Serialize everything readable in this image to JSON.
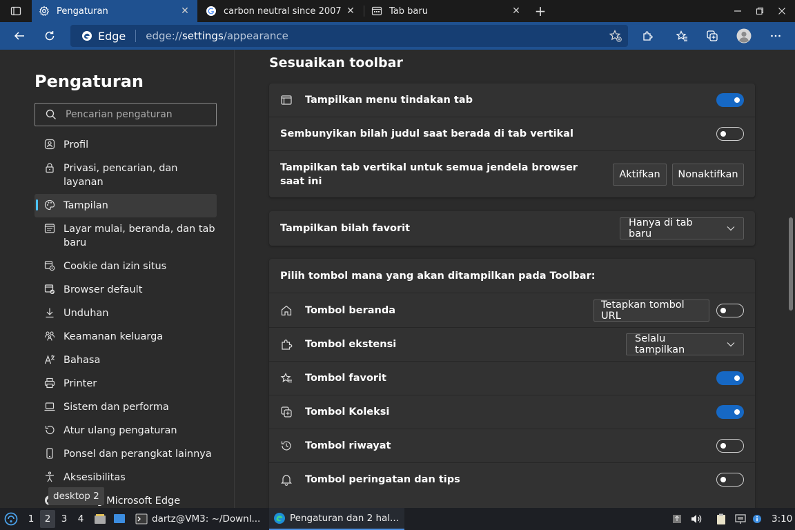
{
  "tabs": [
    {
      "title": "Pengaturan",
      "active": true
    },
    {
      "title": "carbon neutral since 2007",
      "active": false
    },
    {
      "title": "Tab baru",
      "active": false
    }
  ],
  "address": {
    "brand": "Edge",
    "url_prefix": "edge://",
    "url_host": "settings",
    "url_path": "/appearance"
  },
  "sidebar": {
    "title": "Pengaturan",
    "search_placeholder": "Pencarian pengaturan",
    "items": [
      {
        "label": "Profil",
        "icon": "profile-icon"
      },
      {
        "label": "Privasi, pencarian, dan layanan",
        "icon": "lock-icon"
      },
      {
        "label": "Tampilan",
        "icon": "palette-icon",
        "active": true
      },
      {
        "label": "Layar mulai, beranda, dan tab baru",
        "icon": "start-page-icon"
      },
      {
        "label": "Cookie dan izin situs",
        "icon": "cookie-icon"
      },
      {
        "label": "Browser default",
        "icon": "browser-default-icon"
      },
      {
        "label": "Unduhan",
        "icon": "download-icon"
      },
      {
        "label": "Keamanan keluarga",
        "icon": "family-icon"
      },
      {
        "label": "Bahasa",
        "icon": "language-icon"
      },
      {
        "label": "Printer",
        "icon": "printer-icon"
      },
      {
        "label": "Sistem dan performa",
        "icon": "laptop-icon"
      },
      {
        "label": "Atur ulang pengaturan",
        "icon": "reset-icon"
      },
      {
        "label": "Ponsel dan perangkat lainnya",
        "icon": "phone-icon"
      },
      {
        "label": "Aksesibilitas",
        "icon": "accessibility-icon"
      },
      {
        "label": "Tentang Microsoft Edge",
        "icon": "edge-logo-icon"
      }
    ]
  },
  "main": {
    "section_title": "Sesuaikan toolbar",
    "card1": {
      "row1": {
        "label": "Tampilkan menu tindakan tab",
        "toggle": true
      },
      "row2": {
        "label": "Sembunyikan bilah judul saat berada di tab vertikal",
        "toggle": false
      },
      "row3": {
        "label": "Tampilkan tab vertikal untuk semua jendela browser saat ini",
        "btn_on": "Aktifkan",
        "btn_off": "Nonaktifkan"
      }
    },
    "card2": {
      "label": "Tampilkan bilah favorit",
      "value": "Hanya di tab baru"
    },
    "card3": {
      "header": "Pilih tombol mana yang akan ditampilkan pada Toolbar:",
      "home": {
        "label": "Tombol beranda",
        "button": "Tetapkan tombol URL",
        "toggle": false
      },
      "extensions": {
        "label": "Tombol ekstensi",
        "value": "Selalu tampilkan"
      },
      "favorites": {
        "label": "Tombol favorit",
        "toggle": true
      },
      "collections": {
        "label": "Tombol Koleksi",
        "toggle": true
      },
      "history": {
        "label": "Tombol riwayat",
        "toggle": false
      },
      "alerts": {
        "label": "Tombol peringatan dan tips",
        "toggle": false
      }
    }
  },
  "tooltip": "desktop 2",
  "taskbar": {
    "workspaces": [
      "1",
      "2",
      "3",
      "4"
    ],
    "active_workspace": "2",
    "apps": [
      {
        "label": "dartz@VM3: ~/Downl...",
        "icon": "terminal-icon"
      },
      {
        "label": "Pengaturan dan 2 hal...",
        "icon": "edge-icon",
        "active": true
      }
    ],
    "clock": "3:10"
  },
  "colors": {
    "accent": "#1f5190",
    "toggle_on": "#1668c4",
    "background": "#2b2b2b",
    "card": "#323232"
  }
}
